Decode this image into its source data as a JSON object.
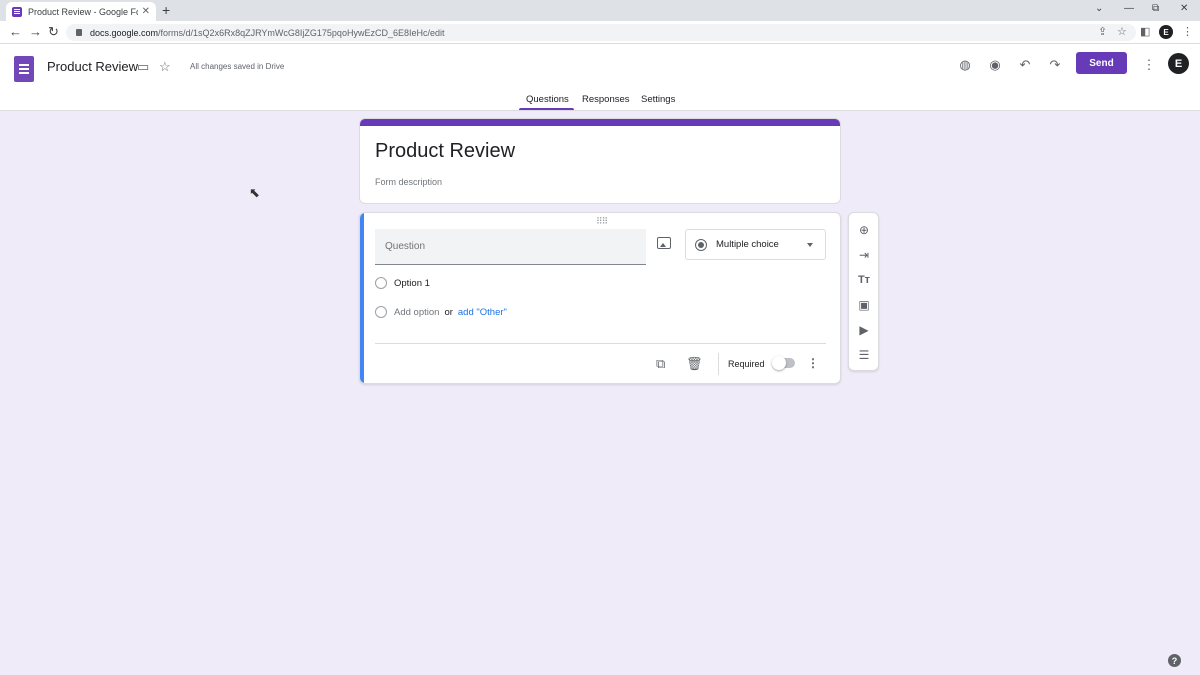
{
  "browser": {
    "tab_title": "Product Review - Google Forms",
    "tab_close": "✕",
    "new_tab": "+",
    "url_host": "docs.google.com",
    "url_path": "/forms/d/1sQ2x6Rx8qZJRYmWcG8IjZG175pqoHywEzCD_6E8IeHc/edit",
    "profile_initial": "E",
    "window_controls": [
      "⌄",
      "—",
      "⧉",
      "✕"
    ]
  },
  "header": {
    "doc_title": "Product Review",
    "saved_status": "All changes saved in Drive",
    "send_label": "Send",
    "avatar_initial": "E",
    "tabs": [
      "Questions",
      "Responses",
      "Settings"
    ],
    "active_tab": "Questions"
  },
  "form": {
    "title": "Product Review",
    "description_placeholder": "Form description"
  },
  "question": {
    "placeholder": "Question",
    "type": "Multiple choice",
    "options": [
      "Option 1"
    ],
    "add_option": "Add option",
    "or": "or",
    "add_other": "add \"Other\"",
    "required_label": "Required",
    "required": false
  },
  "toolbar_tools": [
    "add-question",
    "import-questions",
    "add-title",
    "add-image",
    "add-video",
    "add-section"
  ],
  "colors": {
    "accent": "#673ab7",
    "background": "#f0ebf8",
    "focus_bar": "#4285f4",
    "link": "#1a73e8"
  }
}
